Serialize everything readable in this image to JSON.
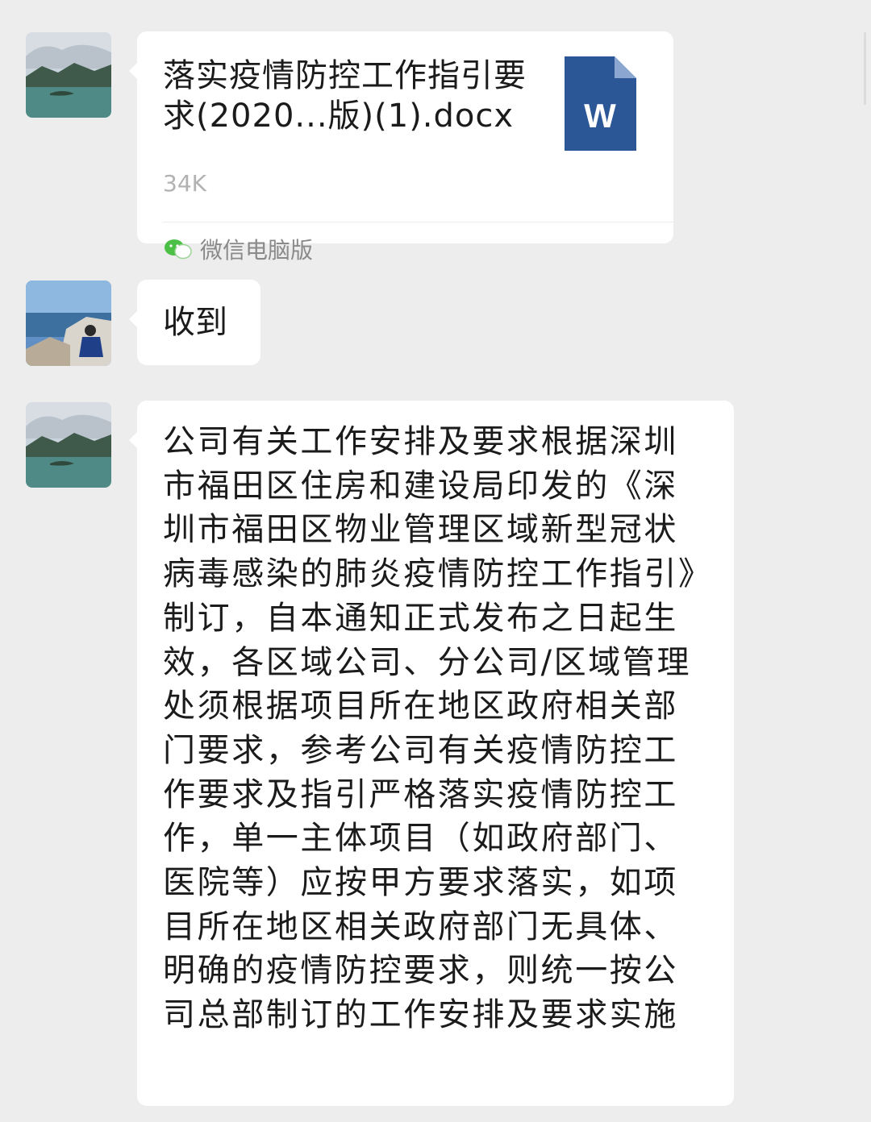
{
  "messages": [
    {
      "type": "file",
      "avatar": "lake-landscape-avatar",
      "file_name": "落实疫情防控工作指引要求(2020...版)(1).docx",
      "file_size": "34K",
      "file_icon": "word-doc-icon",
      "file_icon_letter": "W",
      "source_label": "微信电脑版",
      "source_icon": "wechat-icon"
    },
    {
      "type": "text",
      "avatar": "coast-person-avatar",
      "text": "收到"
    },
    {
      "type": "text",
      "avatar": "lake-landscape-avatar",
      "text": "公司有关工作安排及要求根据深圳市福田区住房和建设局印发的《深圳市福田区物业管理区域新型冠状病毒感染的肺炎疫情防控工作指引》制订，自本通知正式发布之日起生效，各区域公司、分公司/区域管理处须根据项目所在地区政府相关部门要求，参考公司有关疫情防控工作要求及指引严格落实疫情防控工作，单一主体项目（如政府部门、医院等）应按甲方要求落实，如项目所在地区相关政府部门无具体、明确的疫情防控要求，则统一按公司总部制订的工作安排及要求实施"
    }
  ],
  "colors": {
    "background": "#ededed",
    "bubble": "#ffffff",
    "word_blue": "#2b5797",
    "wechat_green": "#4cc046"
  }
}
